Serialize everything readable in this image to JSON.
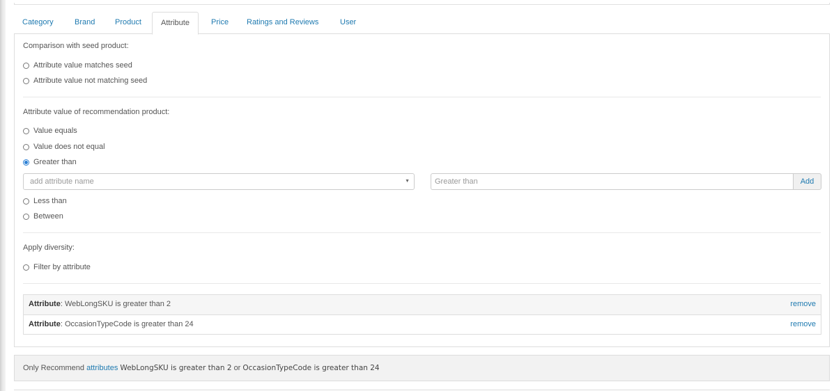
{
  "tabs": [
    {
      "label": "Category"
    },
    {
      "label": "Brand"
    },
    {
      "label": "Product"
    },
    {
      "label": "Attribute",
      "active": true
    },
    {
      "label": "Price"
    },
    {
      "label": "Ratings and Reviews"
    },
    {
      "label": "User"
    }
  ],
  "seed": {
    "heading": "Comparison with seed product:",
    "options": [
      "Attribute value matches seed",
      "Attribute value not matching seed"
    ]
  },
  "rec": {
    "heading": "Attribute value of recommendation product:",
    "options": [
      "Value equals",
      "Value does not equal",
      "Greater than",
      "Less than",
      "Between"
    ],
    "selected": "Greater than"
  },
  "form": {
    "attribute_placeholder": "add attribute name",
    "value_placeholder": "Greater than",
    "add_label": "Add"
  },
  "diversity": {
    "heading": "Apply diversity:",
    "options": [
      "Filter by attribute"
    ]
  },
  "rules": [
    {
      "prefix": "Attribute",
      "text": ": WebLongSKU is greater than 2",
      "remove": "remove"
    },
    {
      "prefix": "Attribute",
      "text": ": OccasionTypeCode is greater than 24",
      "remove": "remove"
    }
  ],
  "summary": {
    "lead": "Only Recommend",
    "link": "attributes",
    "cond1": "WebLongSKU is greater than 2",
    "joiner": "or",
    "cond2": "OccasionTypeCode is greater than 24"
  },
  "colors": {
    "link": "#1f7ab0",
    "radio_checked": "#2a7fd4"
  }
}
